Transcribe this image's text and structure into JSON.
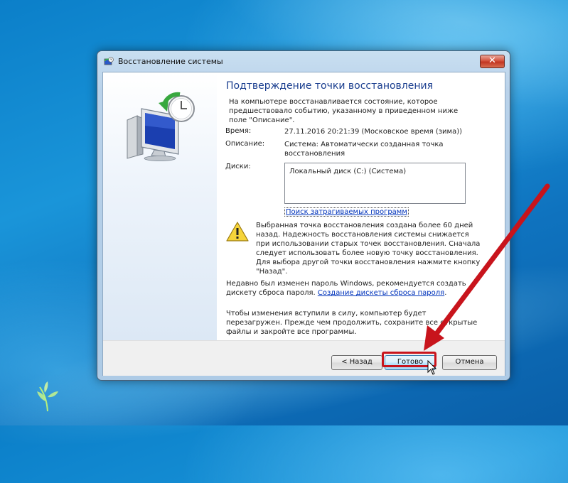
{
  "window": {
    "title": "Восстановление системы",
    "close_symbol": "✕"
  },
  "page": {
    "heading": "Подтверждение точки восстановления",
    "intro": "На компьютере восстанавливается состояние, которое предшествовало событию, указанному в приведенном ниже поле \"Описание\".",
    "time_label": "Время:",
    "time_value": "27.11.2016 20:21:39 (Московское время (зима))",
    "description_label": "Описание:",
    "description_value": "Система: Автоматически созданная точка восстановления",
    "disks_label": "Диски:",
    "disks": [
      "Локальный диск (C:) (Система)"
    ],
    "scan_link": "Поиск затрагиваемых программ",
    "warning_text": "Выбранная точка восстановления создана более 60 дней назад. Надежность восстановления системы снижается при использовании старых точек восстановления. Сначала следует использовать более новую точку восстановления. Для выбора другой точки восстановления нажмите кнопку \"Назад\".",
    "password_text": "Недавно был изменен пароль Windows, рекомендуется создать дискету сброса пароля.",
    "password_link": "Создание дискеты сброса пароля",
    "password_tail": ".",
    "final_text": "Чтобы изменения вступили в силу, компьютер будет перезагружен. Прежде чем продолжить, сохраните все открытые файлы и закройте все программы."
  },
  "buttons": {
    "back": "< Назад",
    "finish": "Готово",
    "cancel": "Отмена"
  },
  "icons": {
    "title": "system-restore-icon",
    "illustration": "monitor-restore-clock-icon",
    "warning": "warning-icon",
    "cursor": "mouse-cursor-icon"
  },
  "colors": {
    "heading": "#1a3e8f",
    "link": "#0033bb",
    "annotation": "#c8141c"
  }
}
